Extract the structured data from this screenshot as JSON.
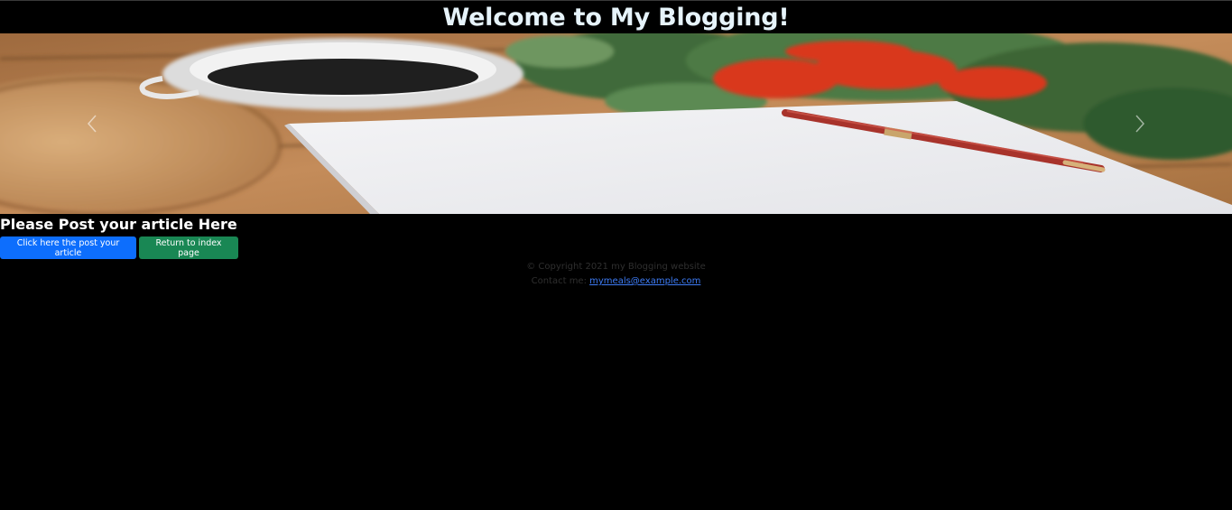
{
  "header": {
    "title": "Welcome to My Blogging!"
  },
  "carousel": {
    "prev_icon": "chevron-left-icon",
    "next_icon": "chevron-right-icon"
  },
  "main": {
    "section_title": "Please Post your article Here",
    "post_button_label": "Click here the post your article",
    "index_button_label": "Return to index page"
  },
  "footer": {
    "copyright": "© Copyright 2021 my Blogging website",
    "contact_label": "Contact me: ",
    "contact_email": "mymeals@example.com"
  },
  "colors": {
    "page_background": "#000000",
    "primary_button": "#0d6efd",
    "success_button": "#198754",
    "link": "#3d7bf5"
  }
}
